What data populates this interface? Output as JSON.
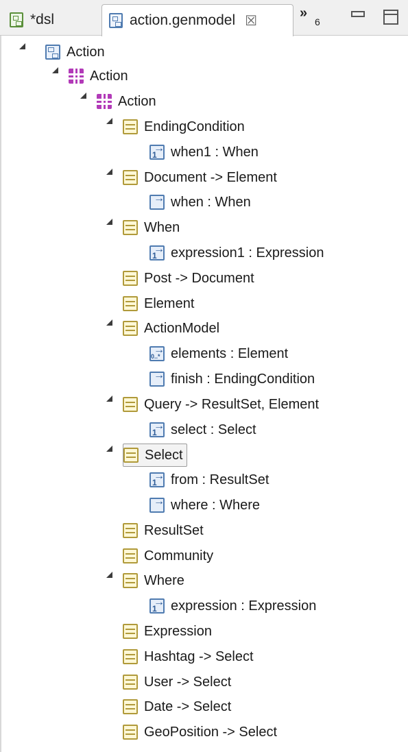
{
  "tabs": [
    {
      "label": "*dsl",
      "icon": "dsl-file-icon"
    },
    {
      "label": "action.genmodel",
      "icon": "genmodel-file-icon",
      "active": true
    }
  ],
  "overflow": {
    "symbol": "»",
    "count": "6"
  },
  "tree": {
    "root": {
      "label": "Action"
    },
    "pkg1": {
      "label": "Action"
    },
    "pkg2": {
      "label": "Action"
    },
    "rows": [
      {
        "label": "EndingCondition",
        "kind": "class"
      },
      {
        "label": "when1 : When",
        "kind": "ref-1"
      },
      {
        "label": "Document -> Element",
        "kind": "class"
      },
      {
        "label": "when : When",
        "kind": "ref"
      },
      {
        "label": "When",
        "kind": "class"
      },
      {
        "label": "expression1 : Expression",
        "kind": "ref-1"
      },
      {
        "label": "Post -> Document",
        "kind": "class"
      },
      {
        "label": "Element",
        "kind": "class"
      },
      {
        "label": "ActionModel",
        "kind": "class"
      },
      {
        "label": "elements : Element",
        "kind": "ref-many"
      },
      {
        "label": "finish : EndingCondition",
        "kind": "ref"
      },
      {
        "label": "Query -> ResultSet, Element",
        "kind": "class"
      },
      {
        "label": "select : Select",
        "kind": "ref-1"
      },
      {
        "label": "Select",
        "kind": "class",
        "selected": true
      },
      {
        "label": "from : ResultSet",
        "kind": "ref-1"
      },
      {
        "label": "where : Where",
        "kind": "ref"
      },
      {
        "label": "ResultSet",
        "kind": "class"
      },
      {
        "label": "Community",
        "kind": "class"
      },
      {
        "label": "Where",
        "kind": "class"
      },
      {
        "label": "expression : Expression",
        "kind": "ref-1"
      },
      {
        "label": "Expression",
        "kind": "class"
      },
      {
        "label": "Hashtag -> Select",
        "kind": "class"
      },
      {
        "label": "User -> Select",
        "kind": "class"
      },
      {
        "label": "Date -> Select",
        "kind": "class"
      },
      {
        "label": "GeoPosition -> Select",
        "kind": "class"
      }
    ]
  }
}
